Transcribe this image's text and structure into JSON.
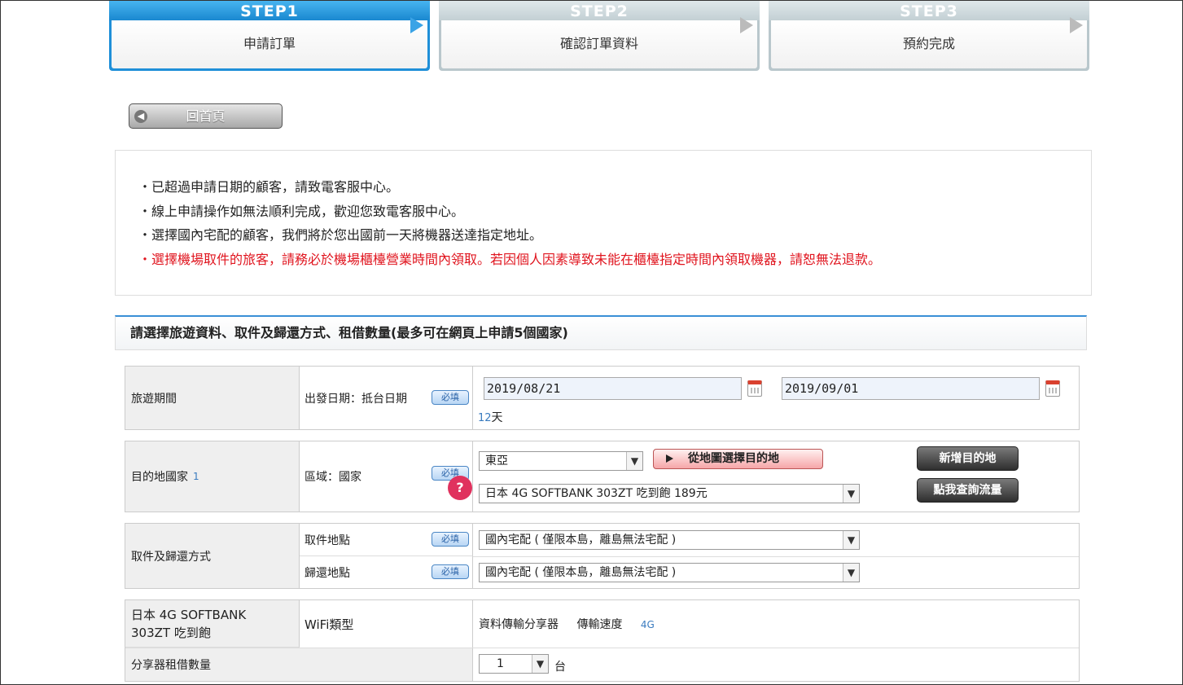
{
  "steps": [
    {
      "head": "STEP1",
      "label": "申請訂單"
    },
    {
      "head": "STEP2",
      "label": "確認訂單資料"
    },
    {
      "head": "STEP3",
      "label": "預約完成"
    }
  ],
  "home_button": "回首頁",
  "notices": [
    "・已超過申請日期的顧客，請致電客服中心。",
    "・線上申請操作如無法順利完成，歡迎您致電客服中心。",
    "・選擇國內宅配的顧客，我們將於您出國前一天將機器送達指定地址。",
    "・選擇機場取件的旅客，請務必於機場櫃檯營業時間內領取。若因個人因素導致未能在櫃檯指定時間內領取機器，請恕無法退款。"
  ],
  "section_title": "請選擇旅遊資料、取件及歸還方式、租借數量(最多可在網頁上申請5個國家)",
  "required_label": "必填",
  "travel": {
    "label": "旅遊期間",
    "sub": "出發日期：抵台日期",
    "start": "2019/08/21",
    "end": "2019/09/01",
    "days_num": "12",
    "days_unit": "天"
  },
  "destination": {
    "label": "目的地國家",
    "count": "1",
    "sub": "區域：國家",
    "region": "東亞",
    "plan": "日本 4G SOFTBANK 303ZT 吃到飽 189元",
    "map_button": "從地圖選擇目的地",
    "add_button": "新增目的地",
    "query_button": "點我查詢流量",
    "help": "?"
  },
  "pickup": {
    "label": "取件及歸還方式",
    "pickup_sub": "取件地點",
    "pickup_value": "國內宅配 ( 僅限本島，離島無法宅配 )",
    "return_sub": "歸還地點",
    "return_value": "國內宅配 ( 僅限本島，離島無法宅配 )"
  },
  "device": {
    "name": "日本 4G SOFTBANK 303ZT 吃到飽",
    "type_label": "WiFi類型",
    "type_value": "資料傳輸分享器",
    "speed_label": "傳輸速度",
    "speed_value": "4G",
    "qty_label": "分享器租借數量",
    "qty_value": "1",
    "qty_unit": "台"
  }
}
